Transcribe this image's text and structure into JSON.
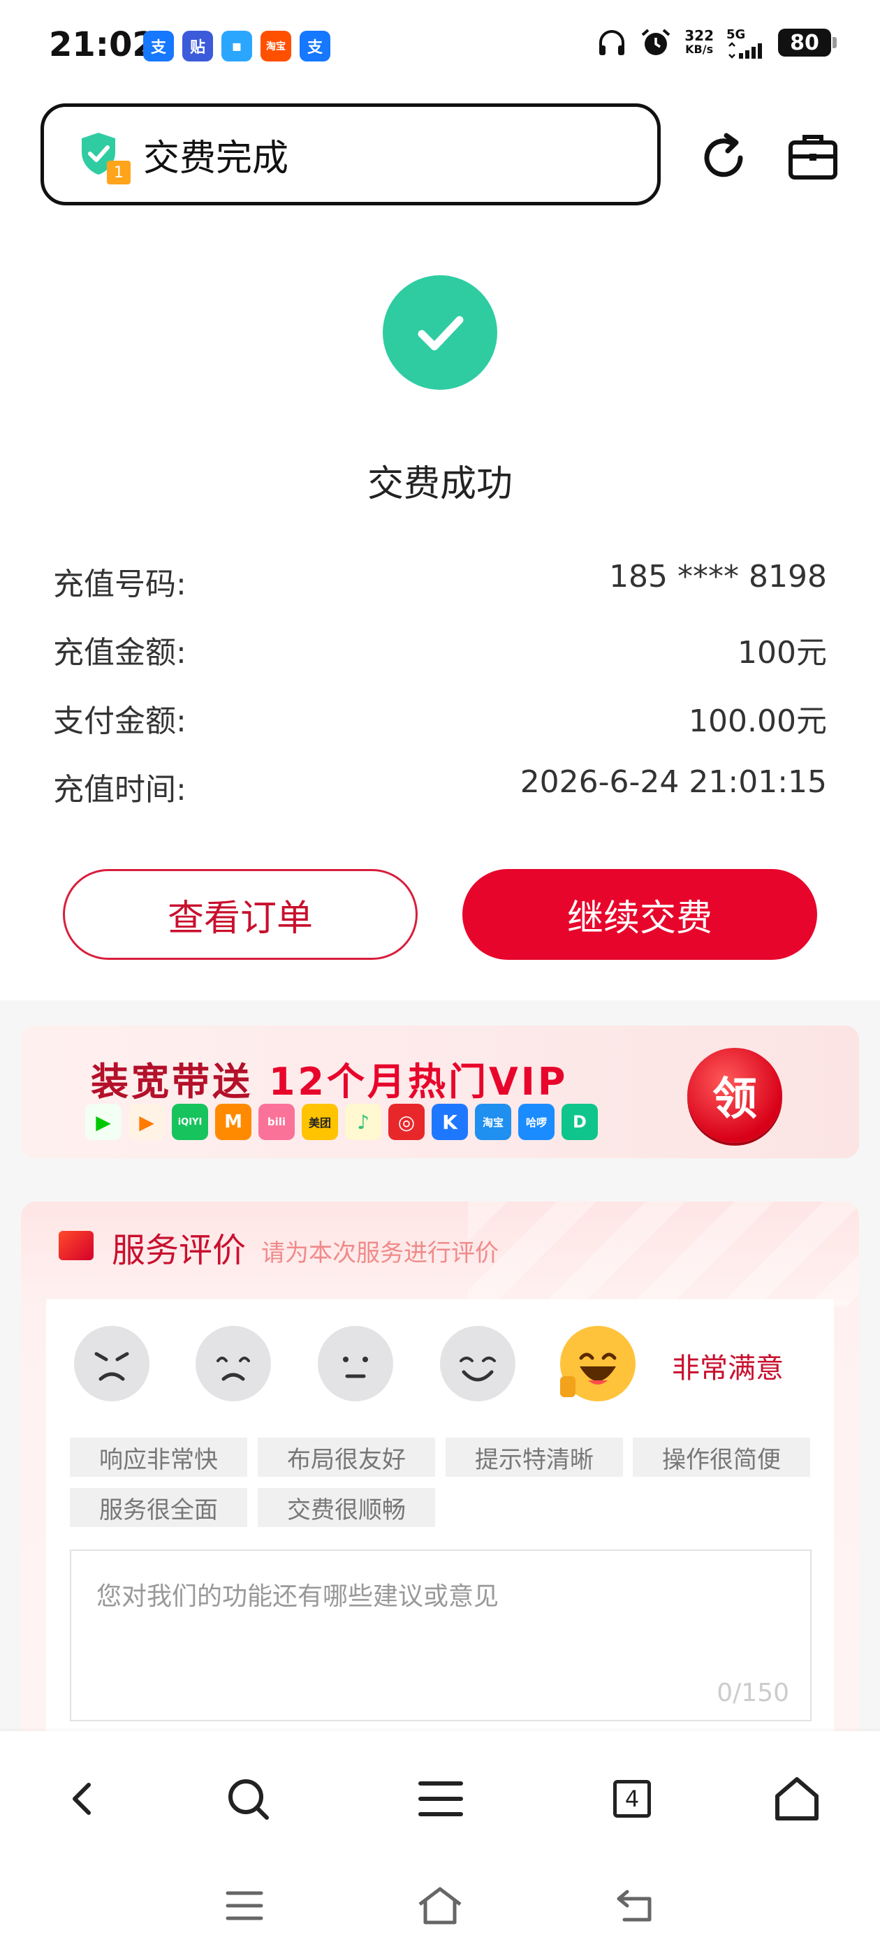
{
  "status_bar": {
    "time": "21:02",
    "apps": [
      {
        "label": "支",
        "color": "#1677ff"
      },
      {
        "label": "贴",
        "color": "#3b5bdb"
      },
      {
        "label": "▪",
        "color": "#2ba6ff"
      },
      {
        "label": "淘宝",
        "color": "#ff5000"
      },
      {
        "label": "支",
        "color": "#1677ff"
      }
    ],
    "speed_value": "322",
    "speed_unit": "KB/s",
    "network": "5G",
    "battery": "80"
  },
  "header": {
    "title": "交费完成",
    "badge": "1"
  },
  "result": {
    "title": "交费成功",
    "rows": [
      {
        "label": "充值号码:",
        "value": "185 **** 8198"
      },
      {
        "label": "充值金额:",
        "value": "100元"
      },
      {
        "label": "支付金额:",
        "value": "100.00元"
      },
      {
        "label": "充值时间:",
        "value": "2026-6-24 21:01:15"
      }
    ]
  },
  "actions": {
    "view_order": "查看订单",
    "continue_pay": "继续交费"
  },
  "promo": {
    "title_a": "装宽带送 ",
    "title_b": "12个月热门VIP",
    "apps": [
      {
        "label": "▶",
        "color": "#00c800"
      },
      {
        "label": "▶",
        "color": "#ff7a00"
      },
      {
        "label": "iQIYI",
        "color": "#16c35c"
      },
      {
        "label": "M",
        "color": "#ff8a00"
      },
      {
        "label": "bili",
        "color": "#fb7299"
      },
      {
        "label": "美团",
        "color": "#ffc300"
      },
      {
        "label": "♪",
        "color": "#ffd400"
      },
      {
        "label": "◎",
        "color": "#e8272b"
      },
      {
        "label": "K",
        "color": "#1e78ff"
      },
      {
        "label": "淘宝",
        "color": "#1f8ff0"
      },
      {
        "label": "哈啰",
        "color": "#1a8cff"
      },
      {
        "label": "D",
        "color": "#10c58b"
      }
    ],
    "claim": "领"
  },
  "review": {
    "title": "服务评价",
    "subtitle": "请为本次服务进行评价",
    "rating_label": "非常满意",
    "tags": [
      "响应非常快",
      "布局很友好",
      "提示特清晰",
      "操作很简便",
      "服务很全面",
      "交费很顺畅"
    ],
    "placeholder": "您对我们的功能还有哪些建议或意见",
    "counter": "0/150"
  },
  "nav": {
    "tab_count": "4"
  }
}
